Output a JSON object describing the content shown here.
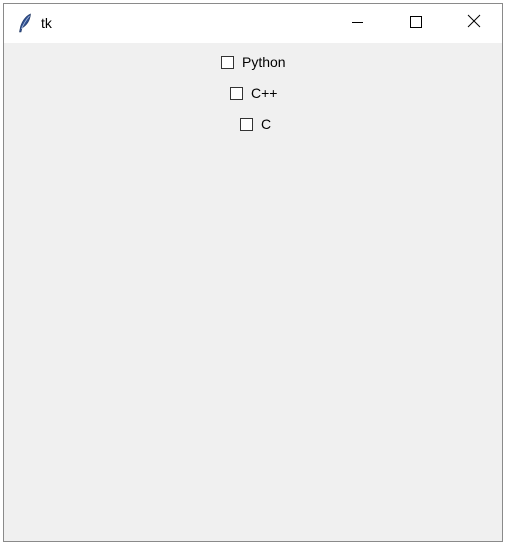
{
  "window": {
    "title": "tk",
    "app_icon": "feather-icon",
    "controls": {
      "minimize_icon": "minimize-icon",
      "maximize_icon": "maximize-icon",
      "close_icon": "close-icon"
    }
  },
  "checkboxes": [
    {
      "label": "Python",
      "checked": false
    },
    {
      "label": "C++",
      "checked": false
    },
    {
      "label": "C",
      "checked": false
    }
  ],
  "colors": {
    "window_background": "#f0f0f0",
    "titlebar_background": "#ffffff",
    "feather_blue": "#2f4f8f"
  }
}
